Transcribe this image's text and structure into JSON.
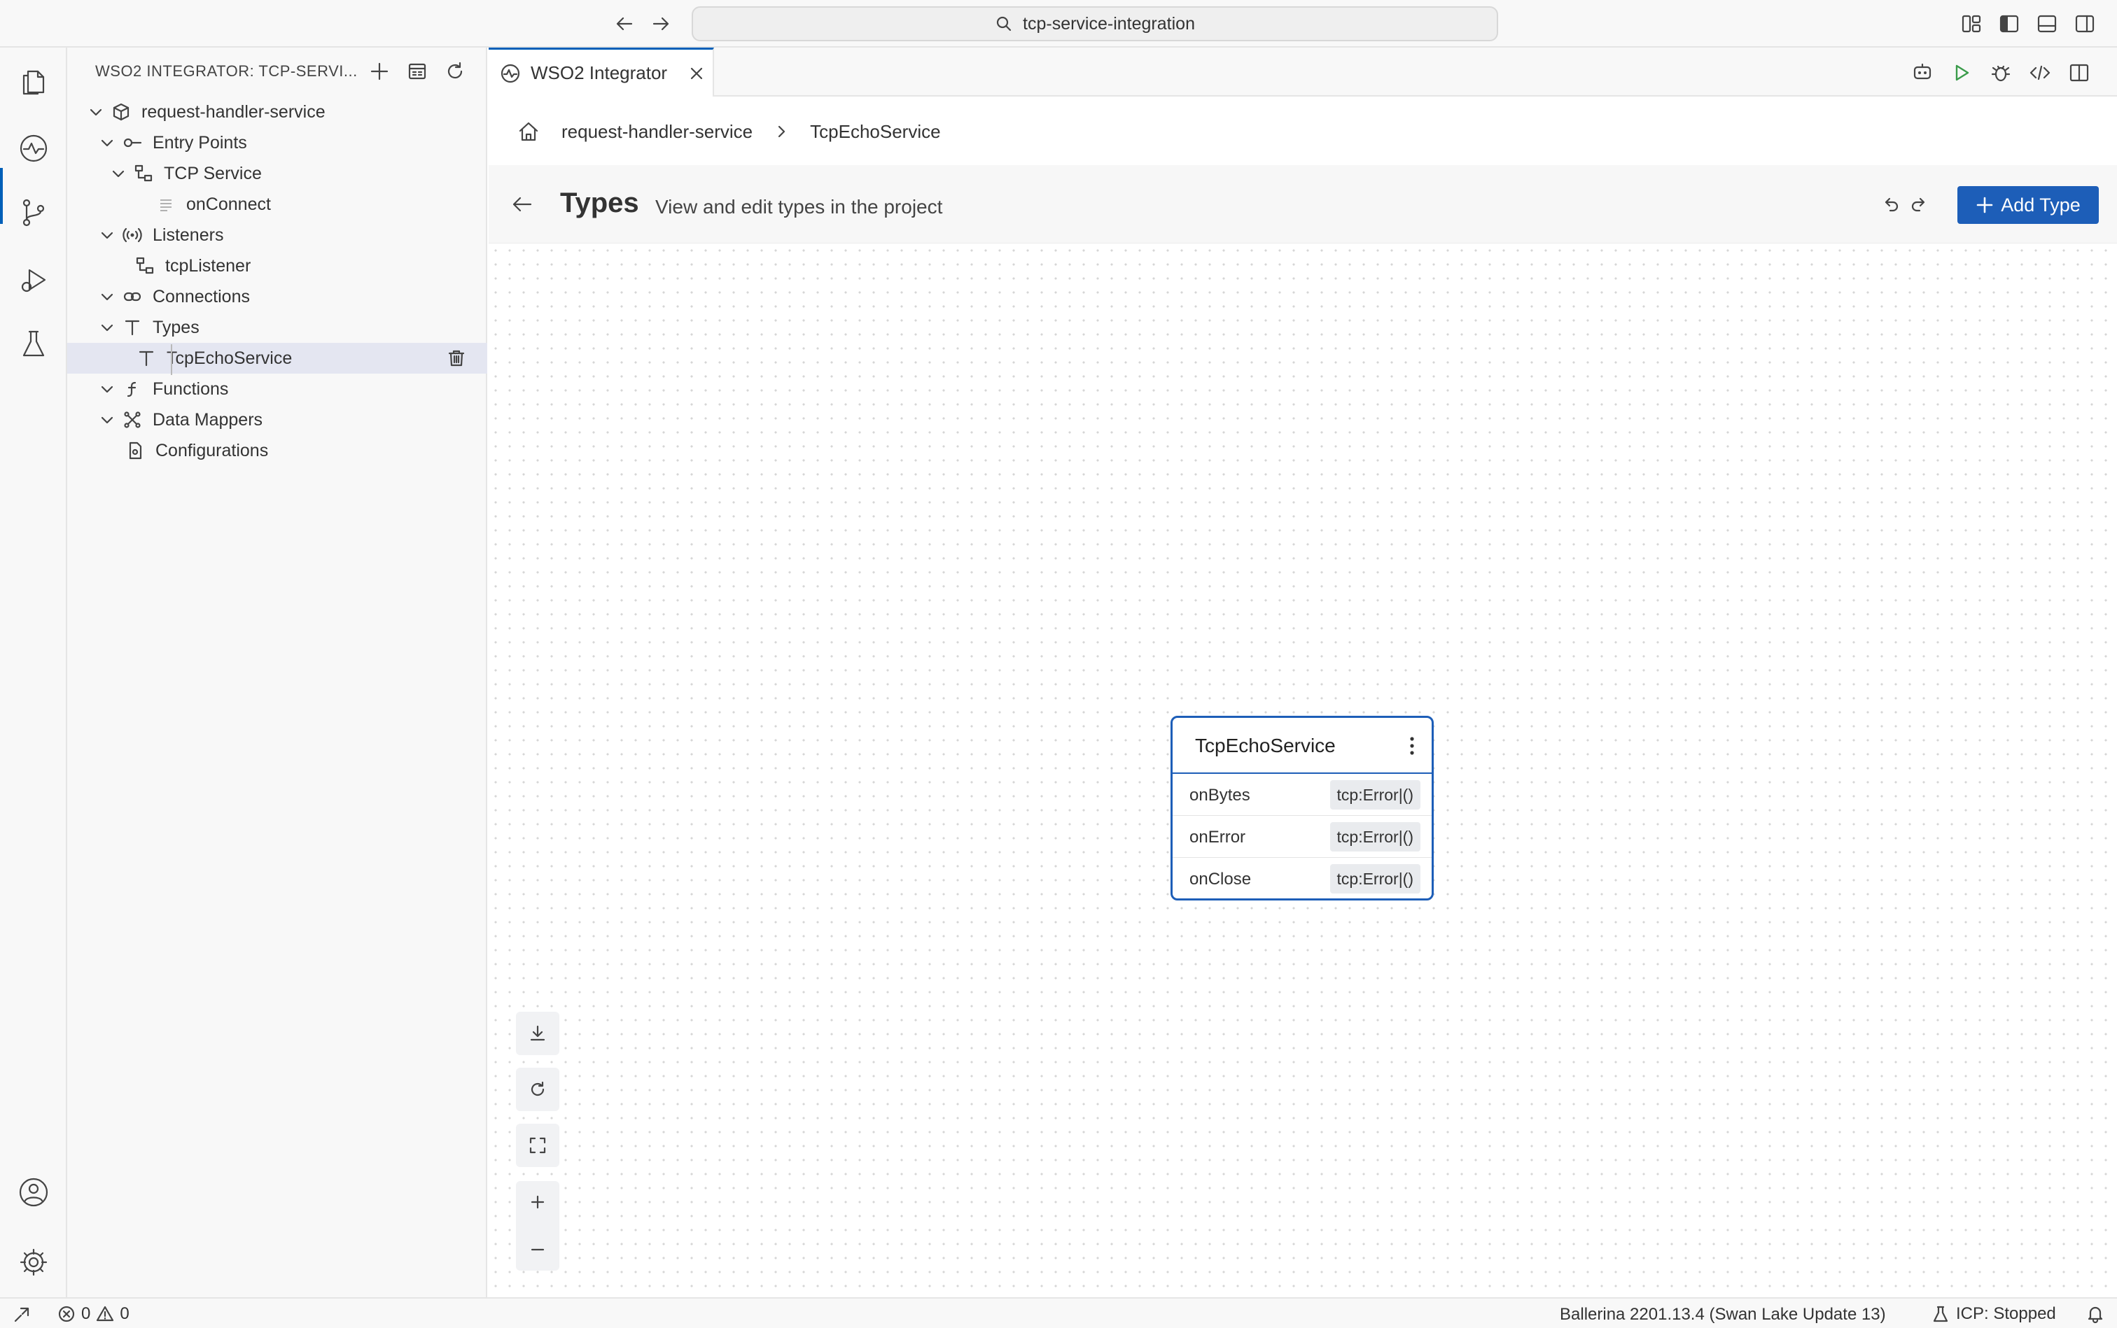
{
  "titlebar": {
    "search_text": "tcp-service-integration"
  },
  "sidebar": {
    "title": "WSO2 INTEGRATOR: TCP-SERVI...",
    "tree": [
      {
        "label": "request-handler-service",
        "icon": "package-icon"
      },
      {
        "label": "Entry Points",
        "icon": "entry-point-icon"
      },
      {
        "label": "TCP Service",
        "icon": "service-icon"
      },
      {
        "label": "onConnect",
        "icon": "resource-icon"
      },
      {
        "label": "Listeners",
        "icon": "broadcast-icon"
      },
      {
        "label": "tcpListener",
        "icon": "listener-icon"
      },
      {
        "label": "Connections",
        "icon": "link-icon"
      },
      {
        "label": "Types",
        "icon": "type-icon"
      },
      {
        "label": "TcpEchoService",
        "icon": "type-icon"
      },
      {
        "label": "Functions",
        "icon": "function-icon"
      },
      {
        "label": "Data Mappers",
        "icon": "data-mapper-icon"
      },
      {
        "label": "Configurations",
        "icon": "config-file-icon"
      }
    ]
  },
  "tabs": [
    {
      "label": "WSO2 Integrator"
    }
  ],
  "breadcrumb": {
    "project": "request-handler-service",
    "current": "TcpEchoService"
  },
  "header": {
    "title": "Types",
    "subtitle": "View and edit types in the project",
    "add_button": "Add Type"
  },
  "type_node": {
    "name": "TcpEchoService",
    "fields": [
      {
        "name": "onBytes",
        "type": "tcp:Error|()"
      },
      {
        "name": "onError",
        "type": "tcp:Error|()"
      },
      {
        "name": "onClose",
        "type": "tcp:Error|()"
      }
    ]
  },
  "statusbar": {
    "errors": "0",
    "warnings": "0",
    "ballerina": "Ballerina 2201.13.4 (Swan Lake Update 13)",
    "icp": "ICP: Stopped"
  },
  "colors": {
    "accent": "#1d5eb8",
    "selection": "#e4e6f1"
  }
}
